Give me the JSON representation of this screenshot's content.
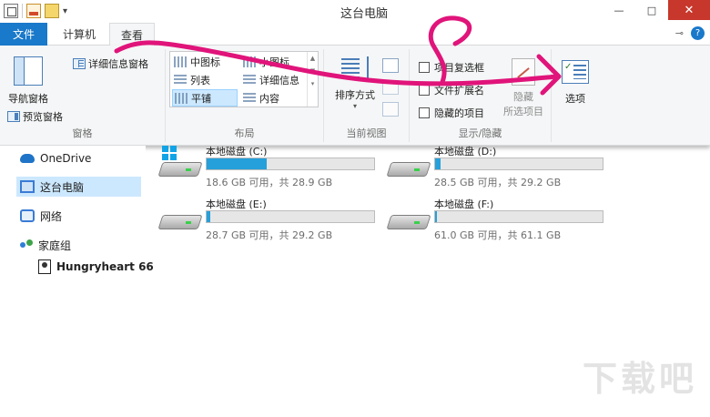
{
  "window": {
    "title": "这台电脑"
  },
  "ribbon_tabs": {
    "file": "文件",
    "computer": "计算机",
    "view": "查看"
  },
  "groups": {
    "panes": {
      "label": "窗格",
      "nav_pane": "导航窗格",
      "preview_pane": "预览窗格",
      "details_pane": "详细信息窗格"
    },
    "layout": {
      "label": "布局",
      "items": [
        "中图标",
        "小图标",
        "列表",
        "详细信息",
        "平铺",
        "内容"
      ],
      "selected": "平铺"
    },
    "current_view": {
      "label": "当前视图",
      "sort_by": "排序方式"
    },
    "show_hide": {
      "label": "显示/隐藏",
      "item_checkboxes": "项目复选框",
      "file_extensions": "文件扩展名",
      "hidden_items": "隐藏的项目",
      "hide_selected_line1": "隐藏",
      "hide_selected_line2": "所选项目"
    },
    "options": {
      "label": "选项"
    }
  },
  "nav": {
    "onedrive": "OneDrive",
    "this_pc": "这台电脑",
    "network": "网络",
    "homegroup": "家庭组",
    "user": "Hungryheart 66"
  },
  "drives": [
    {
      "name": "本地磁盘 (C:)",
      "info": "18.6 GB 可用，共 28.9 GB",
      "used_fraction": 0.36,
      "system": true
    },
    {
      "name": "本地磁盘 (D:)",
      "info": "28.5 GB 可用，共 29.2 GB",
      "used_fraction": 0.03,
      "system": false
    },
    {
      "name": "本地磁盘 (E:)",
      "info": "28.7 GB 可用，共 29.2 GB",
      "used_fraction": 0.02,
      "system": false
    },
    {
      "name": "本地磁盘 (F:)",
      "info": "61.0 GB 可用，共 61.1 GB",
      "used_fraction": 0.01,
      "system": false
    }
  ],
  "icons": {
    "file_menu": "file-tab",
    "help": "help-icon",
    "onedrive": "cloud-icon",
    "this_pc": "computer-icon",
    "network": "network-icon",
    "homegroup": "homegroup-icon",
    "user": "user-icon",
    "options": "options-icon"
  },
  "colors": {
    "accent": "#1979ca",
    "selection": "#cce8ff",
    "drive_fill": "#26a0da",
    "annotation": "#e0147a"
  },
  "watermark": {
    "text": "下载吧"
  }
}
